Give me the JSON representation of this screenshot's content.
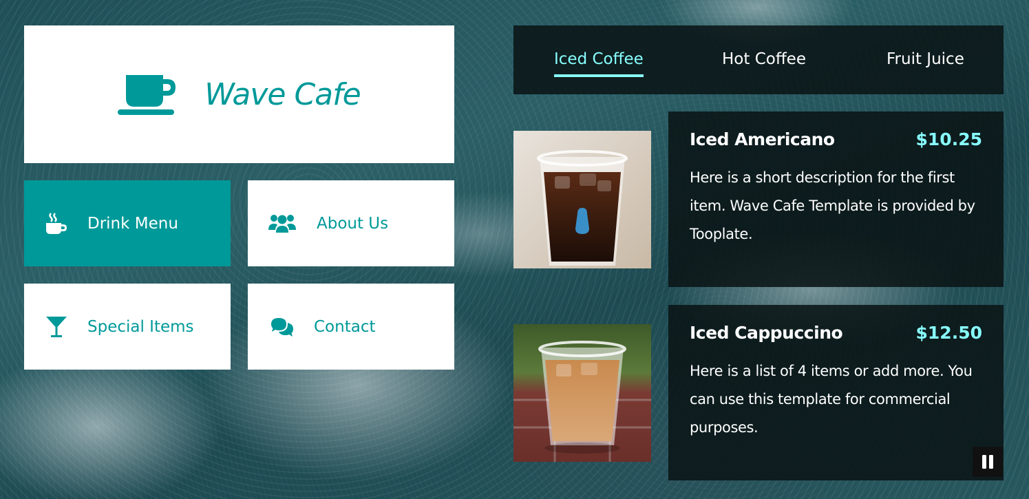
{
  "brand": {
    "name": "Wave Cafe",
    "icon": "coffee-cup-icon",
    "color": "#009999"
  },
  "nav": {
    "items": [
      {
        "label": "Drink Menu",
        "icon": "hot-drink-icon",
        "active": true
      },
      {
        "label": "About Us",
        "icon": "users-icon",
        "active": false
      },
      {
        "label": "Special Items",
        "icon": "cocktail-glass-icon",
        "active": false
      },
      {
        "label": "Contact",
        "icon": "chat-bubbles-icon",
        "active": false
      }
    ]
  },
  "tabs": [
    {
      "label": "Iced Coffee",
      "active": true
    },
    {
      "label": "Hot Coffee",
      "active": false
    },
    {
      "label": "Fruit Juice",
      "active": false
    }
  ],
  "menu_items": [
    {
      "name": "Iced Americano",
      "price": "$10.25",
      "description": "Here is a short description for the first item. Wave Cafe Template is provided by Tooplate.",
      "image": "iced-americano-photo"
    },
    {
      "name": "Iced Cappuccino",
      "price": "$12.50",
      "description": "Here is a list of 4 items or add more. You can use this template for commercial purposes.",
      "image": "iced-cappuccino-photo"
    }
  ],
  "controls": {
    "pause_icon": "pause-icon"
  },
  "colors": {
    "accent": "#009999",
    "highlight": "#88ffff",
    "panel": "#0a1416"
  }
}
